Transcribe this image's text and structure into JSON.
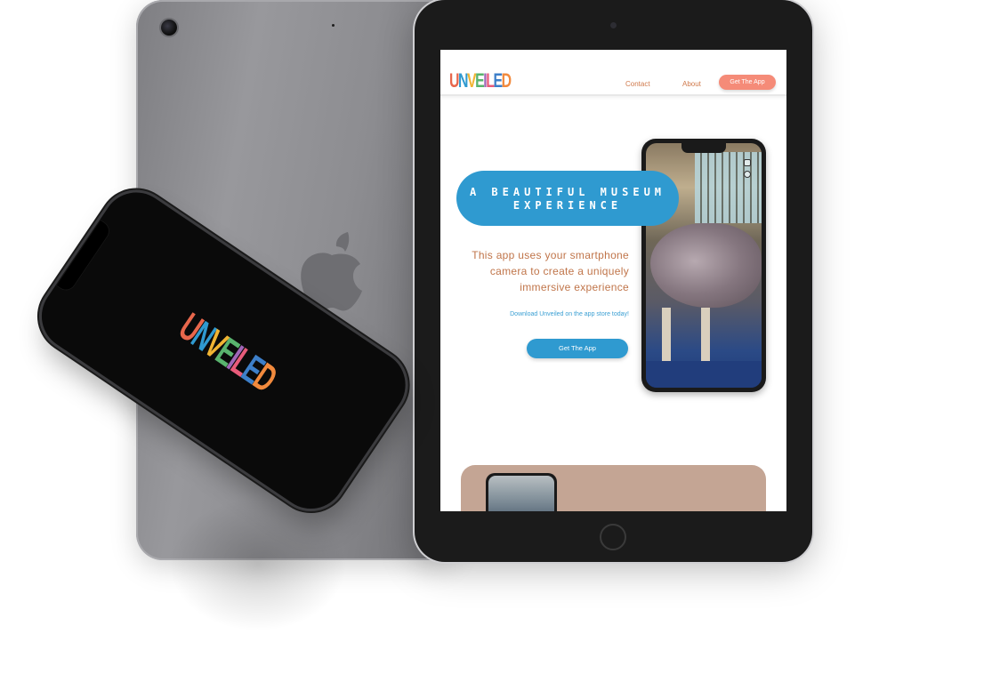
{
  "site": {
    "logo": "UNVEILED",
    "nav": {
      "contact": "Contact",
      "about": "About",
      "cta": "Get The App"
    },
    "hero": {
      "headline_line1": "A BEAUTIFUL MUSEUM",
      "headline_line2": "EXPERIENCE",
      "description_line1": "This app uses your smartphone",
      "description_line2": "camera to create a uniquely",
      "description_line3": "immersive experience",
      "download_text": "Download Unveiled on the app store today!",
      "cta": "Get The App"
    }
  },
  "phone": {
    "splash_logo": "UNVEILED"
  },
  "colors": {
    "accent_blue": "#2f9ad0",
    "accent_coral": "#f58b78",
    "text_orange": "#c0754a",
    "section_tan": "#c4a594"
  }
}
